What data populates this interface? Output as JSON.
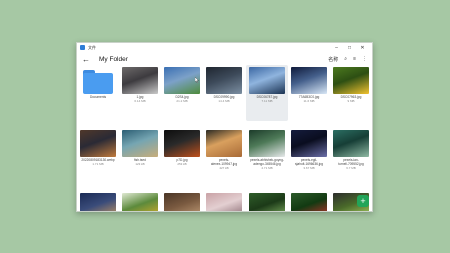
{
  "window": {
    "app_name": "文件"
  },
  "window_controls": {
    "minimize": "–",
    "maximize": "□",
    "close": "✕"
  },
  "toolbar": {
    "back": "←",
    "title": "My Folder",
    "sort_label": "名称",
    "search": "⌕",
    "view": "≡",
    "more": "⋮"
  },
  "items": [
    {
      "name": "Documents",
      "size": "",
      "folder": true
    },
    {
      "name": "1.jpg",
      "size": "6.14 MB",
      "colors": [
        "#6d6a6a",
        "#c9c9c9",
        "#3d3b3f"
      ]
    },
    {
      "name": "D2S4.jpg",
      "size": "21.2 MB",
      "colors": [
        "#3a6fb3",
        "#4e8b3b",
        "#7ca1c8"
      ]
    },
    {
      "name": "DSC09990.jpg",
      "size": "14.4 MB",
      "colors": [
        "#1f2630",
        "#7c8fa2",
        "#3d4a5a"
      ]
    },
    {
      "name": "DSC06787.jpg",
      "size": "7.11 MB",
      "colors": [
        "#3b67a3",
        "#1a3252",
        "#8fb4de"
      ]
    },
    {
      "name": "77A6B3C0.jpg",
      "size": "11.6 MB",
      "colors": [
        "#0f1a3a",
        "#d8e7f6",
        "#45608c"
      ]
    },
    {
      "name": "DSC07963.jpg",
      "size": "9 MB",
      "colors": [
        "#4c7a1f",
        "#f2c22f",
        "#2d4f13"
      ]
    },
    {
      "name": "20220809183130.webp",
      "size": "1.71 MB",
      "colors": [
        "#50382a",
        "#c07a3c",
        "#2a2a35"
      ]
    },
    {
      "name": "fish.tsed",
      "size": "123 kB",
      "colors": [
        "#2b5d73",
        "#c8ad7a",
        "#75a5b2"
      ]
    },
    {
      "name": "p7D.jpg",
      "size": "253 kB",
      "colors": [
        "#0d0d0d",
        "#c0501c",
        "#2a2a2a"
      ]
    },
    {
      "name": "pexels-\nalenex-109947.jpg",
      "size": "427 kB",
      "colors": [
        "#2b2a24",
        "#a86a36",
        "#d9a05e"
      ]
    },
    {
      "name": "pexels-abhishek-goyng-\nadengo-345546.jpg",
      "size": "4.71 MB",
      "colors": [
        "#1c3b2a",
        "#e6e9ea",
        "#4e7a58"
      ]
    },
    {
      "name": "pexels-egil-\nsjøholt-1696636.jpg",
      "size": "3.67 MB",
      "colors": [
        "#151c3d",
        "#6b6fa8",
        "#0a0d1f"
      ]
    },
    {
      "name": "pexels-ian-\nturnell-709552.jpg",
      "size": "6.7 MB",
      "colors": [
        "#2c6f63",
        "#8fb9a3",
        "#163e36"
      ]
    },
    {
      "name": "",
      "size": "",
      "colors": [
        "#1a2a55",
        "#d8a05a",
        "#3a4c7a"
      ]
    },
    {
      "name": "",
      "size": "",
      "colors": [
        "#dfe9d2",
        "#e8b325",
        "#5c8a3c"
      ]
    },
    {
      "name": "",
      "size": "",
      "colors": [
        "#4a3526",
        "#caa57f",
        "#7a5a40"
      ]
    },
    {
      "name": "",
      "size": "",
      "colors": [
        "#c9a2a6",
        "#7a5a62",
        "#e3cfd1"
      ]
    },
    {
      "name": "",
      "size": "",
      "colors": [
        "#2f5d2a",
        "#8ec06a",
        "#1c3a18"
      ]
    },
    {
      "name": "",
      "size": "",
      "colors": [
        "#2c5a2a",
        "#d93030",
        "#123a12"
      ]
    },
    {
      "name": "",
      "size": "",
      "colors": [
        "#2d2d2d",
        "#b8e06a",
        "#4a6a2a"
      ]
    }
  ],
  "fab": {
    "label": "+"
  }
}
